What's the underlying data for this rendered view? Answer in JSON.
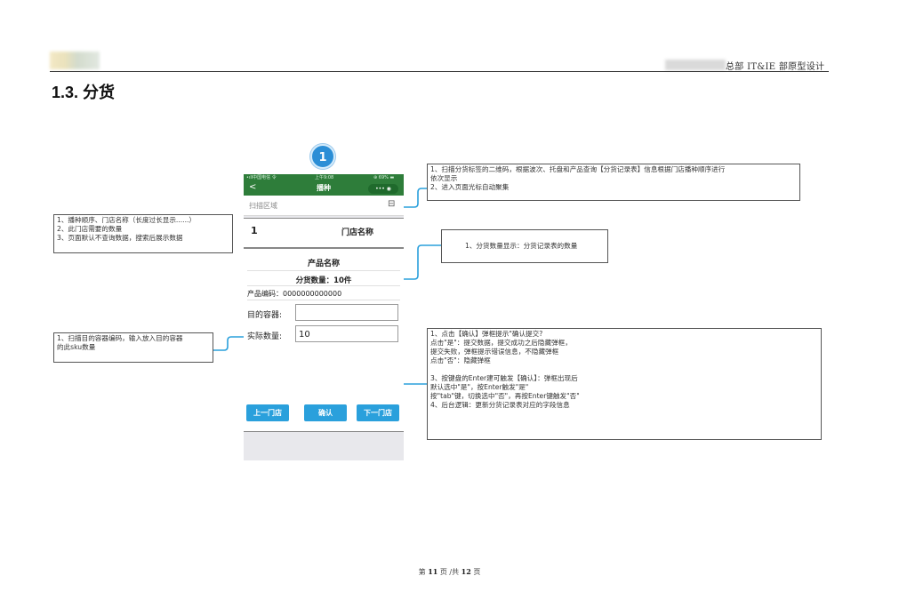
{
  "header": {
    "org_text": "总部 IT&IE 部原型设计",
    "section_title": "1.3. 分货"
  },
  "badge": {
    "number": "1"
  },
  "phone": {
    "status": {
      "carrier": "•ıll中国电信 令",
      "time": "上午9:08",
      "battery": "⊕ 69% ▬"
    },
    "nav": {
      "back_icon": "<",
      "title": "播种",
      "capsule": "••• ◉"
    },
    "scan": {
      "placeholder": "扫描区域",
      "scan_icon": "⊟"
    },
    "card1": {
      "seq": "1",
      "store_name": "门店名称"
    },
    "card2": {
      "product_name": "产品名称",
      "qty_text": "分货数量：10件",
      "product_code": "产品编码：0000000000000",
      "dest_label": "目的容器:",
      "dest_value": "",
      "actual_label": "实际数量:",
      "actual_value": "10"
    },
    "buttons": {
      "prev": "上一门店",
      "confirm": "确认",
      "next": "下一门店"
    }
  },
  "notes": {
    "top": [
      "1、扫描分货标签的二维码，根据波次、托盘和产品查询【分货记录表】信息根据门店播种顺序进行",
      "依次显示",
      "2、进入页面光标自动聚集"
    ],
    "left_top": [
      "1、播种顺序、门店名称（长度过长显示......）",
      "2、此门店需要的数量",
      "3、页面默认不查询数据，搜索后展示数据"
    ],
    "qty": [
      "1、分货数量显示：分货记录表的数量"
    ],
    "left_bottom": [
      "1、扫描目的容器编码，输入放入目的容器",
      "的此sku数量"
    ],
    "confirm": [
      "1、点击【确认】弹框提示\"确认提交?",
      "          点击\"是\"：提交数据，提交成功之后隐藏弹框，",
      "          提交失败，弹框提示错误信息，不隐藏弹框",
      "          点击\"否\"：隐藏弹框",
      "",
      "3、按键盘的Enter建可触发【确认】：弹框出现后",
      "          默认选中\"是\"，按Enter触发\"是\"",
      "          按\"tab\"键，切换选中\"否\"，再按Enter键触发\"否\"",
      "4、后台逻辑：更新分货记录表对应的字段信息"
    ]
  },
  "footer": {
    "page_prefix": "第",
    "page_current": "11",
    "page_mid": "页 /共",
    "page_total": "12",
    "page_suffix": "页"
  },
  "colors": {
    "accent": "#2aa0dc",
    "nav_green": "#2e7d3a",
    "badge_blue": "#2b8ed6",
    "connector": "#2aa0dc"
  }
}
